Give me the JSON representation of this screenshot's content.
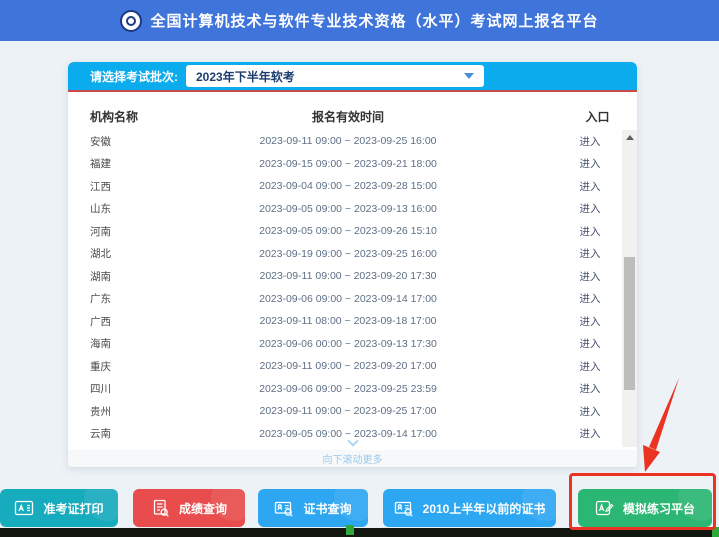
{
  "header": {
    "title": "全国计算机技术与软件专业技术资格（水平）考试网上报名平台"
  },
  "filter": {
    "label": "请选择考试批次:",
    "selected_option": "2023年下半年软考"
  },
  "table": {
    "columns": {
      "name": "机构名称",
      "time": "报名有效时间",
      "entry": "入口"
    },
    "entry_label": "进入",
    "rows": [
      {
        "name": "安徽",
        "time": "2023-09-11 09:00 ~ 2023-09-25 16:00"
      },
      {
        "name": "福建",
        "time": "2023-09-15 09:00 ~ 2023-09-21 18:00"
      },
      {
        "name": "江西",
        "time": "2023-09-04 09:00 ~ 2023-09-28 15:00"
      },
      {
        "name": "山东",
        "time": "2023-09-05 09:00 ~ 2023-09-13 16:00"
      },
      {
        "name": "河南",
        "time": "2023-09-05 09:00 ~ 2023-09-26 15:10"
      },
      {
        "name": "湖北",
        "time": "2023-09-19 09:00 ~ 2023-09-25 16:00"
      },
      {
        "name": "湖南",
        "time": "2023-09-11 09:00 ~ 2023-09-20 17:30"
      },
      {
        "name": "广东",
        "time": "2023-09-06 09:00 ~ 2023-09-14 17:00"
      },
      {
        "name": "广西",
        "time": "2023-09-11 08:00 ~ 2023-09-18 17:00"
      },
      {
        "name": "海南",
        "time": "2023-09-06 00:00 ~ 2023-09-13 17:30"
      },
      {
        "name": "重庆",
        "time": "2023-09-11 09:00 ~ 2023-09-20 17:00"
      },
      {
        "name": "四川",
        "time": "2023-09-06 09:00 ~ 2023-09-25 23:59"
      },
      {
        "name": "贵州",
        "time": "2023-09-11 09:00 ~ 2023-09-25 17:00"
      },
      {
        "name": "云南",
        "time": "2023-09-05 09:00 ~ 2023-09-14 17:00"
      }
    ],
    "scroll_hint": "向下滚动更多"
  },
  "footer_buttons": [
    {
      "label": "准考证打印",
      "color": "#17ABBE",
      "icon": "admission-card-icon",
      "highlighted": false
    },
    {
      "label": "成绩查询",
      "color": "#E84C4C",
      "icon": "score-search-icon",
      "highlighted": false
    },
    {
      "label": "证书查询",
      "color": "#2EA7F2",
      "icon": "certificate-search-icon",
      "highlighted": false
    },
    {
      "label": "2010上半年以前的证书",
      "color": "#2EA7F2",
      "icon": "certificate-search-icon",
      "highlighted": false
    },
    {
      "label": "模拟练习平台",
      "color": "#2BB673",
      "icon": "practice-edit-icon",
      "highlighted": true
    }
  ],
  "annotation": {
    "type": "arrow-and-box-highlight",
    "color": "#EA3323",
    "target": "模拟练习平台"
  },
  "colors": {
    "header_blue": "#3F74DA",
    "filter_cyan": "#0BACEE",
    "underline_red": "#C94A4A"
  }
}
